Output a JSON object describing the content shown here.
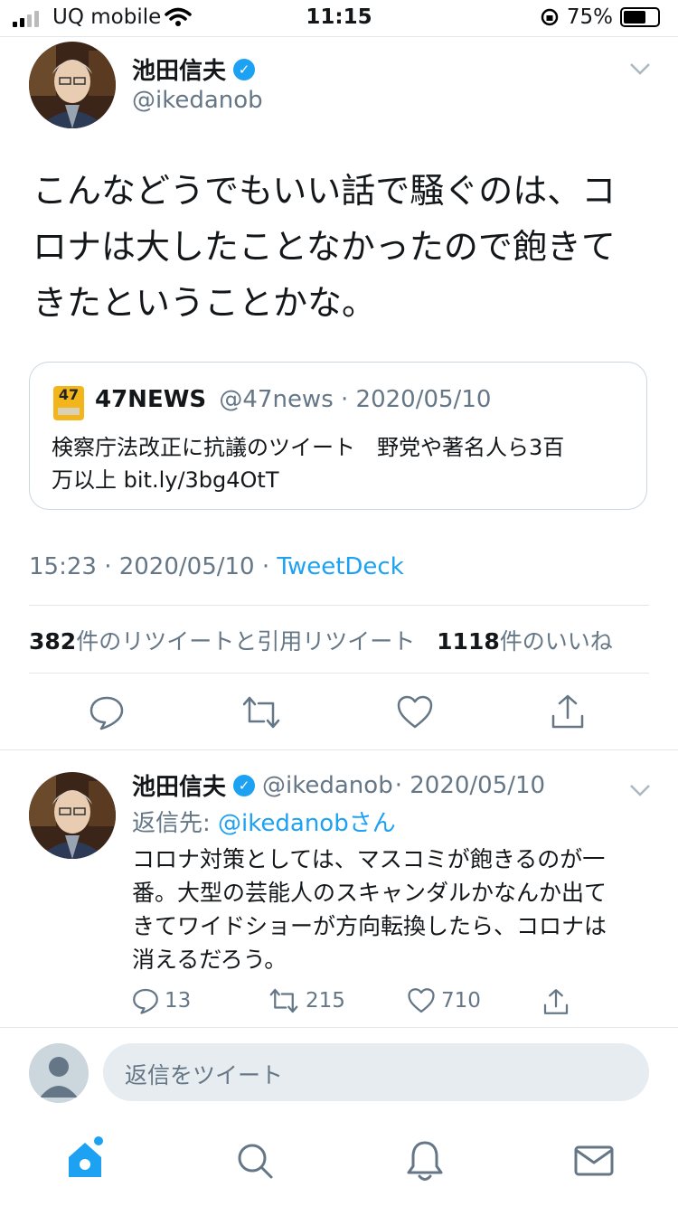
{
  "status_bar": {
    "carrier": "UQ mobile",
    "time": "11:15",
    "battery": "75%",
    "battery_level": 0.75
  },
  "tweet": {
    "author_name": "池田信夫",
    "author_handle": "@ikedanob",
    "text_lines": [
      "こんなどうでもいい話で騒ぐのは、コ",
      "ロナは大したことなかったので飽きて",
      "きたということかな。"
    ],
    "quote": {
      "logo_text": "47",
      "name": "47NEWS",
      "handle": "@47news",
      "date": "· 2020/05/10",
      "text_lines": [
        "検察庁法改正に抗議のツイート　野党や著名人ら3百",
        "万以上 bit.ly/3bg4OtT"
      ]
    },
    "timestamp": "15:23 · 2020/05/10 · ",
    "source": "TweetDeck",
    "retweet_count": "382",
    "retweet_label": "件のリツイートと引用リツイート",
    "like_count": "1118",
    "like_label": "件のいいね"
  },
  "reply": {
    "author_name": "池田信夫",
    "author_handle": "@ikedanob",
    "date": "· 2020/05/10",
    "reply_to_label": "返信先: ",
    "reply_to_handle": "@ikedanobさん",
    "text_lines": [
      "コロナ対策としては、マスコミが飽きるのが一",
      "番。大型の芸能人のスキャンダルかなんか出て",
      "きてワイドショーが方向転換したら、コロナは",
      "消えるだろう。"
    ],
    "reply_count": "13",
    "retweet_count": "215",
    "like_count": "710"
  },
  "composer": {
    "placeholder": "返信をツイート"
  },
  "colors": {
    "accent": "#1da1f2",
    "muted": "#657786",
    "border": "#e1e8ed"
  }
}
